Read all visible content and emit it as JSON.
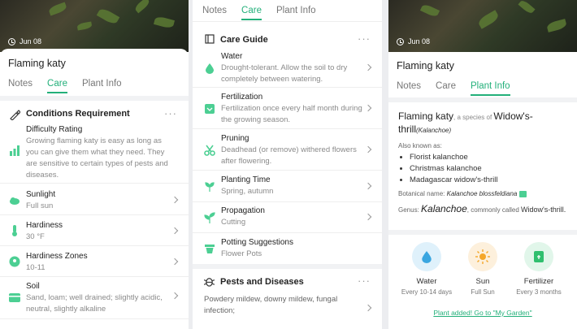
{
  "panel1": {
    "date": "Jun 08",
    "plant_name": "Flaming katy",
    "tabs": [
      "Notes",
      "Care",
      "Plant Info"
    ],
    "active_tab": "Care",
    "conditions": {
      "title": "Conditions Requirement",
      "difficulty_title": "Difficulty Rating",
      "difficulty_text": "Growing flaming katy is easy as long as you can give them what they need. They are sensitive to certain types of pests and diseases."
    },
    "items": [
      {
        "title": "Sunlight",
        "value": "Full sun",
        "icon": "cloud-sun-icon"
      },
      {
        "title": "Hardiness",
        "value": "30 °F",
        "icon": "thermometer-icon"
      },
      {
        "title": "Hardiness Zones",
        "value": "10-11",
        "icon": "map-pin-icon"
      },
      {
        "title": "Soil",
        "value": "Sand, loam; well drained; slightly acidic, neutral, slightly alkaline",
        "icon": "soil-icon"
      }
    ]
  },
  "panel2": {
    "tabs": [
      "Notes",
      "Care",
      "Plant Info"
    ],
    "active_tab": "Care",
    "care_guide": {
      "title": "Care Guide",
      "items": [
        {
          "title": "Water",
          "value": "Drought-tolerant. Allow the soil to dry completely between watering.",
          "icon": "water-drop-icon"
        },
        {
          "title": "Fertilization",
          "value": "Fertilization once every half month during the growing season.",
          "icon": "fertilizer-icon"
        },
        {
          "title": "Pruning",
          "value": "Deadhead (or remove) withered flowers after flowering.",
          "icon": "scissors-icon"
        },
        {
          "title": "Planting Time",
          "value": "Spring, autumn",
          "icon": "sprout-icon"
        },
        {
          "title": "Propagation",
          "value": "Cutting",
          "icon": "seedling-icon"
        },
        {
          "title": "Potting Suggestions",
          "value": "Flower Pots",
          "icon": "pot-icon"
        }
      ]
    },
    "pests": {
      "title": "Pests and Diseases",
      "value": "Powdery mildew, downy mildew, fungal infection;"
    }
  },
  "panel3": {
    "date": "Jun 08",
    "plant_name": "Flaming katy",
    "tabs": [
      "Notes",
      "Care",
      "Plant Info"
    ],
    "active_tab": "Plant Info",
    "info": {
      "name": "Flaming katy",
      "species_of": ", a species of",
      "species": "Widow's-thrill",
      "scientific": "(Kalanchoe)",
      "also_known_label": "Also known as:",
      "aliases": [
        "Florist kalanchoe",
        "Christmas kalanchoe",
        "Madagascar widow's-thrill"
      ],
      "botanical_label": "Botanical name:",
      "botanical_name": "Kalanchoe blossfeldiana",
      "genus_label": "Genus:",
      "genus": "Kalanchoe",
      "commonly_called": ", commonly called",
      "common_name": "Widow's-thrill",
      "period": "."
    },
    "care_cards": [
      {
        "label": "Water",
        "sub": "Every 10-14 days",
        "color": "#dff1fb"
      },
      {
        "label": "Sun",
        "sub": "Full Sun",
        "color": "#fdf0dc"
      },
      {
        "label": "Fertilizer",
        "sub": "Every 3 months",
        "color": "#e1f6ea"
      }
    ],
    "added_link": "Plant added! Go to \"My Garden\""
  },
  "colors": {
    "accent": "#23b07a",
    "icon_green": "#4ccf93"
  }
}
